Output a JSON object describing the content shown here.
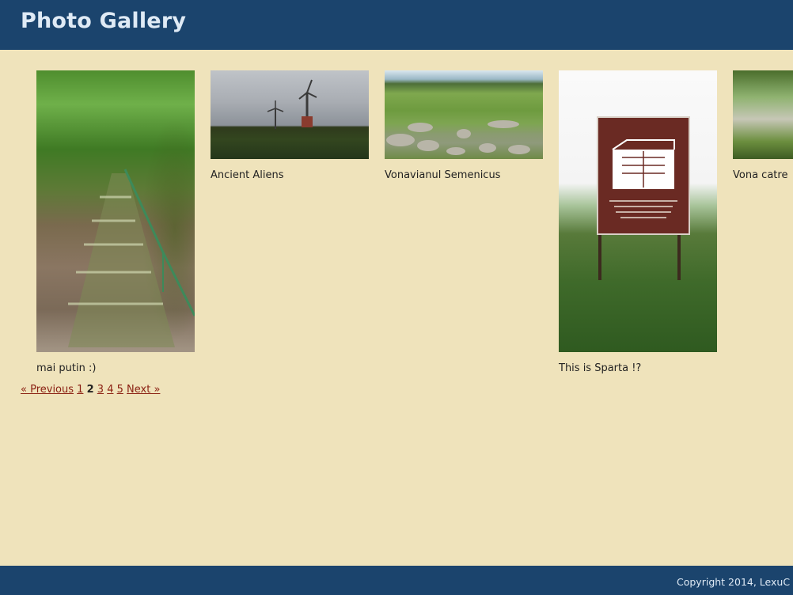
{
  "header": {
    "title": "Photo Gallery"
  },
  "gallery": {
    "items": [
      {
        "caption": "mai putin :)"
      },
      {
        "caption": "Ancient Aliens"
      },
      {
        "caption": "Vonavianul Semenicus"
      },
      {
        "caption": "This is Sparta !?"
      },
      {
        "caption": "Vona catre"
      }
    ]
  },
  "pagination": {
    "previous": "« Previous",
    "pages": [
      "1",
      "2",
      "3",
      "4",
      "5"
    ],
    "current": "2",
    "next": "Next »"
  },
  "footer": {
    "copyright": "Copyright 2014, LexuC"
  },
  "colors": {
    "header_bg": "#1b446d",
    "page_bg": "#efe3bb",
    "link": "#8a1f11"
  }
}
